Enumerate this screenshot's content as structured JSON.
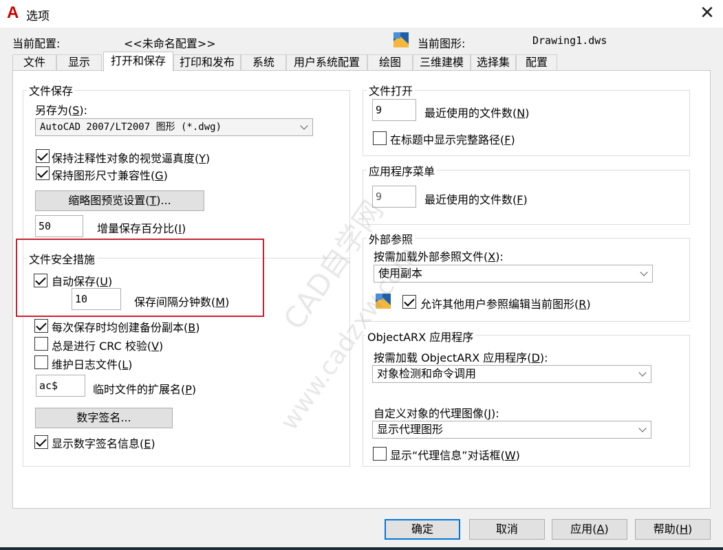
{
  "window": {
    "title": "选项",
    "logo_letter": "A",
    "close_glyph": "✕"
  },
  "profile": {
    "label": "当前配置:",
    "value": "<<未命名配置>>",
    "drawing_label": "当前图形:",
    "drawing_value": "Drawing1.dws"
  },
  "tabs": [
    {
      "label": "文件"
    },
    {
      "label": "显示"
    },
    {
      "label": "打开和保存"
    },
    {
      "label": "打印和发布"
    },
    {
      "label": "系统"
    },
    {
      "label": "用户系统配置"
    },
    {
      "label": "绘图"
    },
    {
      "label": "三维建模"
    },
    {
      "label": "选择集"
    },
    {
      "label": "配置"
    }
  ],
  "active_tab": "打开和保存",
  "file_save": {
    "title": "文件保存",
    "saveas_label": "另存为(",
    "saveas_key": "S",
    "saveas_suffix": "):",
    "saveas_value": "AutoCAD 2007/LT2007 图形 (*.dwg)",
    "keep_annot": {
      "text": "保持注释性对象的视觉逼真度(",
      "key": "Y",
      "end": ")"
    },
    "keep_dim": {
      "text": "保持图形尺寸兼容性(",
      "key": "G",
      "end": ")"
    },
    "thumb_btn": {
      "text": "缩略图预览设置(",
      "key": "T",
      "end": ")..."
    },
    "incr_value": "50",
    "incr_label": {
      "text": "增量保存百分比(",
      "key": "I",
      "end": ")"
    }
  },
  "file_safety": {
    "title": "文件安全措施",
    "autosave": {
      "text": "自动保存(",
      "key": "U",
      "end": ")"
    },
    "interval_value": "10",
    "interval_label": {
      "text": "保存间隔分钟数(",
      "key": "M",
      "end": ")"
    },
    "backup": {
      "text": "每次保存时均创建备份副本(",
      "key": "B",
      "end": ")"
    },
    "crc": {
      "text": "总是进行 CRC 校验(",
      "key": "V",
      "end": ")"
    },
    "log": {
      "text": "维护日志文件(",
      "key": "L",
      "end": ")"
    },
    "ext_value": "ac$",
    "ext_label": {
      "text": "临时文件的扩展名(",
      "key": "P",
      "end": ")"
    },
    "sig_btn": "数字签名...",
    "show_sig": {
      "text": "显示数字签名信息(",
      "key": "E",
      "end": ")"
    }
  },
  "file_open": {
    "title": "文件打开",
    "recent_value": "9",
    "recent_label": {
      "text": "最近使用的文件数(",
      "key": "N",
      "end": ")"
    },
    "fullpath": {
      "text": "在标题中显示完整路径(",
      "key": "F",
      "end": ")"
    }
  },
  "app_menu": {
    "title": "应用程序菜单",
    "recent_value": "9",
    "recent_label": {
      "text": "最近使用的文件数(",
      "key": "F",
      "end": ")"
    }
  },
  "xref": {
    "title": "外部参照",
    "demand_label": {
      "text": "按需加载外部参照文件(",
      "key": "X",
      "end": "):"
    },
    "demand_value": "使用副本",
    "allow_edit": {
      "text": "允许其他用户参照编辑当前图形(",
      "key": "R",
      "end": ")"
    }
  },
  "objectarx": {
    "title": "ObjectARX 应用程序",
    "demand_label": {
      "text": "按需加载 ObjectARX 应用程序(",
      "key": "D",
      "end": "):"
    },
    "demand_value": "对象检测和命令调用",
    "proxy_label": {
      "text": "自定义对象的代理图像(",
      "key": "J",
      "end": "):"
    },
    "proxy_value": "显示代理图形",
    "proxy_dialog": {
      "text": "显示“代理信息”对话框(",
      "key": "W",
      "end": ")"
    }
  },
  "buttons": {
    "ok": "确定",
    "cancel": "取消",
    "apply": {
      "text": "应用(",
      "key": "A",
      "end": ")"
    },
    "help": {
      "text": "帮助(",
      "key": "H",
      "end": ")"
    }
  },
  "watermark": {
    "line1": "CAD自学网",
    "line2": "www.cadzxw.com"
  },
  "colors": {
    "highlight": "#c9212f",
    "primary_border": "#0078d7",
    "logo": "#cc0000"
  }
}
